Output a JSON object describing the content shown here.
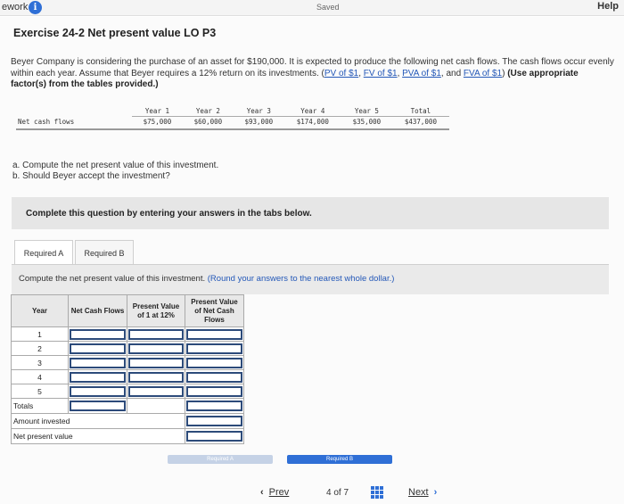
{
  "topbar": {
    "title": "ework",
    "info_icon": "i",
    "saved": "Saved",
    "help": "Help"
  },
  "exercise": {
    "title": "Exercise 24-2 Net present value LO P3",
    "problem_text": "Beyer Company is considering the purchase of an asset for $190,000. It is expected to produce the following net cash flows. The cash flows occur evenly within each year. Assume that Beyer requires a 12% return on its investments.",
    "links": [
      "PV of $1",
      "FV of $1",
      "PVA of $1",
      "FVA of $1"
    ],
    "instruction": "(Use appropriate factor(s) from the tables provided.)"
  },
  "cash_flows": {
    "row_label": "Net cash flows",
    "headers": [
      "Year 1",
      "Year 2",
      "Year 3",
      "Year 4",
      "Year 5",
      "Total"
    ],
    "values": [
      "$75,000",
      "$60,000",
      "$93,000",
      "$174,000",
      "$35,000",
      "$437,000"
    ]
  },
  "questions": [
    "a. Compute the net present value of this investment.",
    "b. Should Beyer accept the investment?"
  ],
  "complete_notice": "Complete this question by entering your answers in the tabs below.",
  "tabs": [
    {
      "label": "Required A",
      "active": true
    },
    {
      "label": "Required B",
      "active": false
    }
  ],
  "panel": {
    "prompt": "Compute the net present value of this investment.",
    "hint": "(Round your answers to the nearest whole dollar.)"
  },
  "npv_table": {
    "headers": [
      "Year",
      "Net Cash Flows",
      "Present Value of 1 at 12%",
      "Present Value of Net Cash Flows"
    ],
    "years": [
      "1",
      "2",
      "3",
      "4",
      "5"
    ],
    "totals_label": "Totals",
    "amount_invested_label": "Amount invested",
    "npv_label": "Net present value"
  },
  "nav": {
    "prev_required": "Required A",
    "next_required": "Required B",
    "prev_label": "Prev",
    "page_current": "4",
    "page_of": "of",
    "page_total": "7",
    "next_label": "Next"
  },
  "colors": {
    "accent": "#2f6fd6",
    "link": "#2458b8",
    "input_border": "#2d4b7a"
  }
}
